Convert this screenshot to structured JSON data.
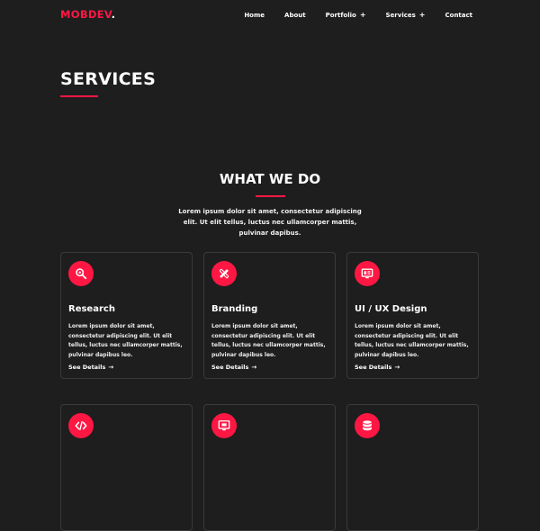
{
  "brand": {
    "name": "MOBDEV",
    "dot": "."
  },
  "nav": {
    "items": [
      {
        "label": "Home"
      },
      {
        "label": "About"
      },
      {
        "label": "Portfolio",
        "plus": "+"
      },
      {
        "label": "Services",
        "plus": "+"
      },
      {
        "label": "Contact"
      }
    ]
  },
  "page": {
    "title": "SERVICES"
  },
  "section": {
    "title": "WHAT WE DO",
    "description": "Lorem ipsum dolor sit amet, consectetur adipiscing elit. Ut elit tellus, luctus nec ullamcorper mattis, pulvinar dapibus."
  },
  "colors": {
    "accent": "#ff1744",
    "background": "#1e1e1e",
    "card_border": "#3a3a3a"
  },
  "cards": [
    {
      "icon": "research-icon",
      "title": "Research",
      "text": "Lorem ipsum dolor sit amet, consectetur adipiscing elit. Ut elit tellus, luctus nec ullamcorper mattis, pulvinar dapibus leo.",
      "link": "See Details",
      "arrow": "→"
    },
    {
      "icon": "branding-icon",
      "title": "Branding",
      "text": "Lorem ipsum dolor sit amet, consectetur adipiscing elit. Ut elit tellus, luctus nec ullamcorper mattis, pulvinar dapibus leo.",
      "link": "See Details",
      "arrow": "→"
    },
    {
      "icon": "ui-ux-design-icon",
      "title": "UI / UX Design",
      "text": "Lorem ipsum dolor sit amet, consectetur adipiscing elit. Ut elit tellus, luctus nec ullamcorper mattis, pulvinar dapibus leo.",
      "link": "See Details",
      "arrow": "→"
    },
    {
      "icon": "code-icon"
    },
    {
      "icon": "monitor-icon"
    },
    {
      "icon": "database-icon"
    }
  ]
}
